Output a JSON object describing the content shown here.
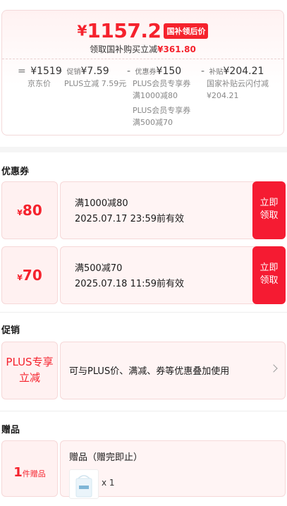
{
  "price_summary": {
    "currency_symbol": "¥",
    "final_price": "1157.2",
    "tag": "国补领后价",
    "subtitle_prefix": "领取国补购买立减",
    "subtitle_amount": "¥361.80",
    "breakdown": [
      {
        "op": "=",
        "value": "¥1519",
        "label": "",
        "notes": [
          "京东价"
        ]
      },
      {
        "op": "-",
        "value": "¥7.59",
        "label": "促销",
        "notes": [
          "PLUS立减 7.59元"
        ]
      },
      {
        "op": "-",
        "value": "¥150",
        "label": "优惠券",
        "notes": [
          "PLUS会员专享券",
          "满1000减80",
          "PLUS会员专享券",
          "满500减70"
        ]
      },
      {
        "op": "-",
        "value": "¥204.21",
        "label": "补贴",
        "notes": [
          "国家补贴云闪付减",
          "¥204.21"
        ]
      }
    ]
  },
  "coupons_section": {
    "title": "优惠券",
    "coupons": [
      {
        "yen": "¥",
        "amount": "80",
        "condition": "满1000减80",
        "expiry": "2025.07.17 23:59前有效",
        "button": "立即领取"
      },
      {
        "yen": "¥",
        "amount": "70",
        "condition": "满500减70",
        "expiry": "2025.07.18 11:59前有效",
        "button": "立即领取"
      }
    ]
  },
  "promo_section": {
    "title": "促销",
    "badge_line1": "PLUS专享",
    "badge_line2": "立减",
    "description": "可与PLUS价、满减、券等优惠叠加使用",
    "chevron_icon": "chevron-right-icon"
  },
  "gift_section": {
    "title": "赠品",
    "count": "1",
    "count_unit": "件赠品",
    "heading": "赠品（赠完即止）",
    "quantity": "x 1"
  },
  "colors": {
    "accent": "#f5222d",
    "button": "#f51b32"
  }
}
